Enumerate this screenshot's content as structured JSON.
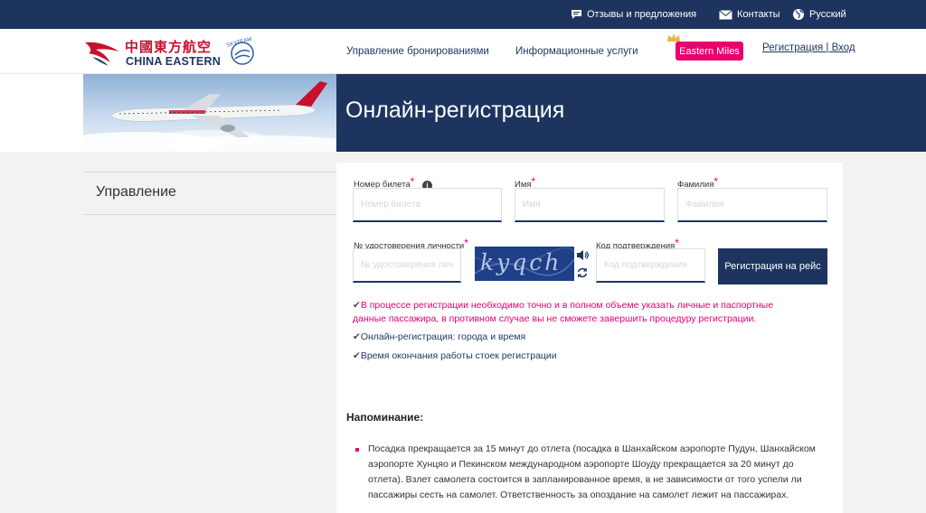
{
  "topbar": {
    "feedback": "Отзывы и предложения",
    "contacts": "Контакты",
    "language": "Русский"
  },
  "header": {
    "logo_cn": "中國東方航空",
    "logo_en": "CHINA EASTERN",
    "skyteam": "SKYTEAM",
    "nav": [
      "Управление бронированиями",
      "Информационные услуги"
    ],
    "miles": "Eastern Miles",
    "login": "Регистрация | Вход"
  },
  "banner": {
    "title": "Онлайн-регистрация"
  },
  "sidebar": {
    "items": [
      {
        "label": "Управление"
      }
    ]
  },
  "form": {
    "ticket": {
      "label": "Номер билета",
      "placeholder": "Номер билета"
    },
    "first_name": {
      "label": "Имя",
      "placeholder": "Имя"
    },
    "last_name": {
      "label": "Фамилия",
      "placeholder": "Фамилия"
    },
    "id_doc": {
      "label": "№ удостоверения личности",
      "placeholder": "№ удостоверения личности"
    },
    "captcha_text": "kyqch",
    "code": {
      "label": "Код подтверждения",
      "placeholder": "Код подтверждения"
    },
    "submit": "Регистрация на рейс",
    "star": "*",
    "info": "i"
  },
  "notes": {
    "check": "✔",
    "warning": "В процессе регистрации необходимо точно и в полном объеме указать личные и паспортные данные пассажира, в противном случае вы не сможете завершить процедуру регистрации.",
    "cities": "Онлайн-регистрация: города и время",
    "deadline": "Время окончания работы стоек регистрации"
  },
  "reminder": {
    "title": "Напоминание:",
    "bullets": [
      "Посадка прекращается за 15 минут до отлета (посадка в Шанхайском аэропорте Пудун, Шанхайском аэропорте Хунцяо и Пекинском международном аэропорте Шоуду прекращается за 20 минут до отлета). Взлет самолета состоится в запланированное время, в не зависимости от того успели ли пассажиры сесть на самолет. Ответственность за опоздание на самолет лежит на пассажирах."
    ]
  },
  "colors": {
    "navy": "#1d355e",
    "pink": "#e8006f",
    "red": "#c8102e"
  }
}
